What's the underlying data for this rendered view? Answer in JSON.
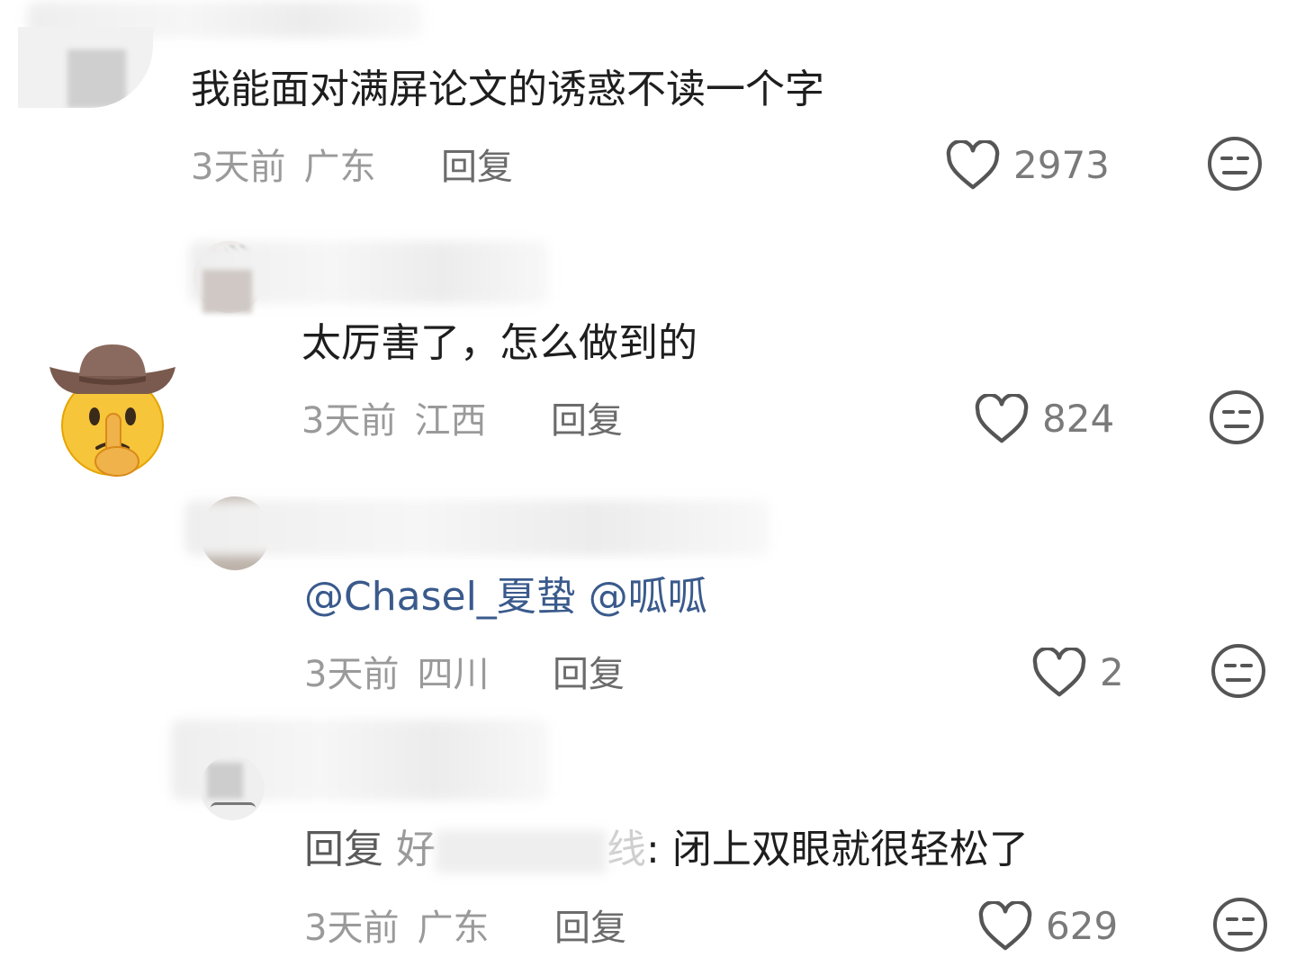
{
  "comments": [
    {
      "text": "我能面对满屏论文的诱惑不读一个字",
      "time": "3天前",
      "location": "广东",
      "reply_label": "回复",
      "likes": "2973"
    },
    {
      "text": "太厉害了，怎么做到的",
      "time": "3天前",
      "location": "江西",
      "reply_label": "回复",
      "likes": "824"
    },
    {
      "mention1": "@Chasel_夏蛰",
      "mention2": "@呱呱",
      "time": "3天前",
      "location": "四川",
      "reply_label": "回复",
      "likes": "2"
    },
    {
      "reply_prefix": "回复",
      "reply_to": "好",
      "reply_to_tail": "线",
      "reply_sep": ":",
      "text": "闭上双眼就很轻松了",
      "time": "3天前",
      "location": "广东",
      "reply_label": "回复",
      "likes": "629"
    }
  ],
  "icons": {
    "like": "heart-outline-icon",
    "dislike": "meh-face-icon",
    "sticker": "cowboy-shush-emoji"
  },
  "colors": {
    "meta": "#9a9a9a",
    "mention": "#3a5a8c",
    "text": "#1e1e1e"
  }
}
